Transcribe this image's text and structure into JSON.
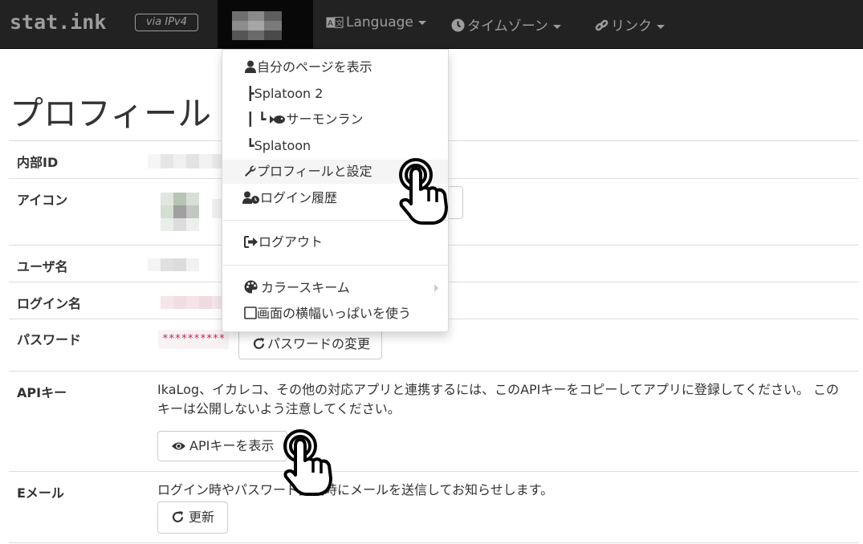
{
  "navbar": {
    "brand": "stat.ink",
    "via_badge": "via IPv4",
    "menus": [
      {
        "label": "Language",
        "icon": "language-icon"
      },
      {
        "label": "タイムゾーン",
        "icon": "clock-icon"
      },
      {
        "label": "リンク",
        "icon": "link-icon"
      }
    ]
  },
  "user_dropdown": {
    "items": [
      {
        "label": "自分のページを表示",
        "icon": "user-icon"
      },
      {
        "label": "┣Splatoon 2"
      },
      {
        "label": "┃ ┗",
        "sub": "サーモンラン",
        "icon": "fish-icon"
      },
      {
        "label": "┗Splatoon"
      },
      {
        "label": "プロフィールと設定",
        "icon": "wrench-icon"
      },
      {
        "label": "ログイン履歴",
        "icon": "user-clock-icon"
      },
      {
        "label": "ログアウト",
        "icon": "sign-out-icon"
      },
      {
        "label": "カラースキーム",
        "icon": "palette-icon"
      },
      {
        "label": "画面の横幅いっぱいを使う",
        "icon": "checkbox-icon"
      }
    ]
  },
  "page": {
    "title": "プロフィール",
    "rows": {
      "internal_id": "内部ID",
      "icon": "アイコン",
      "username": "ユーザ名",
      "login_name": "ログイン名",
      "password": "パスワード",
      "api_key": "APIキー",
      "email": "Eメール"
    },
    "password_mask": "**********",
    "change_password_button": "パスワードの変更",
    "api_key_description": "IkaLog、イカレコ、その他の対応アプリと連携するには、このAPIキーをコピーしてアプリに登録してください。 このキーは公開しないよう注意してください。",
    "show_api_key_button": "APIキーを表示",
    "email_description": "ログイン時やパスワード変更時にメールを送信してお知らせします。",
    "update_button": "更新"
  },
  "colors": {
    "navbar_bg": "#222222",
    "navbar_text": "#9d9d9d",
    "password_text": "#c7254e"
  }
}
